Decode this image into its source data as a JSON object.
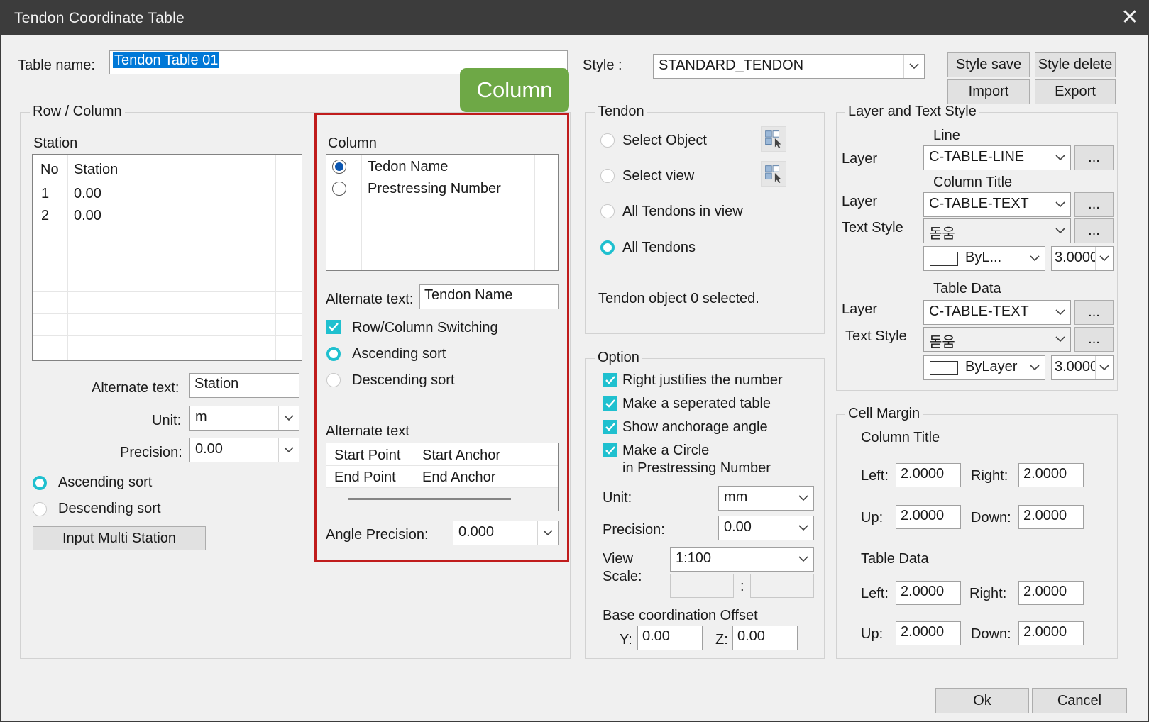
{
  "window": {
    "title": "Tendon Coordinate Table",
    "close_symbol": "✕"
  },
  "table_name": {
    "label": "Table name:",
    "value": "Tendon Table 01"
  },
  "style": {
    "label": "Style :",
    "value": "STANDARD_TENDON",
    "save": "Style save",
    "delete": "Style delete",
    "import": "Import",
    "export": "Export"
  },
  "callout": {
    "text": "Column",
    "color": "#6ea846",
    "highlight_color": "#c01c1c"
  },
  "row_column": {
    "title": "Row / Column",
    "station_label": "Station",
    "headers": [
      "No",
      "Station"
    ],
    "rows": [
      {
        "no": "1",
        "station": "0.00"
      },
      {
        "no": "2",
        "station": "0.00"
      }
    ],
    "alt_text_label": "Alternate text:",
    "alt_text_value": "Station",
    "unit_label": "Unit:",
    "unit_value": "m",
    "precision_label": "Precision:",
    "precision_value": "0.00",
    "ascending": "Ascending sort",
    "descending": "Descending sort",
    "input_multi": "Input Multi Station"
  },
  "column": {
    "title": "Column",
    "items": [
      "Tedon Name",
      "Prestressing Number"
    ],
    "alt_text_label": "Alternate text:",
    "alt_text_value": "Tendon Name",
    "switching": "Row/Column Switching",
    "ascending": "Ascending sort",
    "descending": "Descending sort",
    "alt_text_section": "Alternate text",
    "alt_rows": [
      {
        "a": "Start Point",
        "b": "Start Anchor"
      },
      {
        "a": "End Point",
        "b": "End Anchor"
      }
    ],
    "angle_label": "Angle Precision:",
    "angle_value": "0.000"
  },
  "tendon": {
    "title": "Tendon",
    "select_object": "Select Object",
    "select_view": "Select view",
    "all_in_view": "All Tendons in view",
    "all_tendons": "All Tendons",
    "status": "Tendon object 0 selected."
  },
  "option": {
    "title": "Option",
    "right_justify": "Right justifies the number",
    "separated": "Make a seperated table",
    "anchorage": "Show anchorage angle",
    "circle_1": "Make a Circle",
    "circle_2": "in Prestressing Number",
    "unit_label": "Unit:",
    "unit_value": "mm",
    "precision_label": "Precision:",
    "precision_value": "0.00",
    "view_label_1": "View",
    "view_label_2": "Scale:",
    "view_value": "1:100",
    "colon": ":",
    "base_label": "Base coordination Offset",
    "y_label": "Y:",
    "y_value": "0.00",
    "z_label": "Z:",
    "z_value": "0.00"
  },
  "layer_text": {
    "title": "Layer and Text Style",
    "line": "Line",
    "layer": "Layer",
    "line_layer": "C-TABLE-LINE",
    "column_title": "Column Title",
    "ct_layer": "C-TABLE-TEXT",
    "text_style": "Text Style",
    "ct_font": "돋움",
    "ct_color": "ByL...",
    "ct_height": "3.0000",
    "table_data": "Table Data",
    "td_layer": "C-TABLE-TEXT",
    "td_font": "돋움",
    "td_color": "ByLayer",
    "td_height": "3.0000",
    "dots": "..."
  },
  "cell_margin": {
    "title": "Cell Margin",
    "column_title": "Column Title",
    "table_data": "Table Data",
    "left": "Left:",
    "right": "Right:",
    "up": "Up:",
    "down": "Down:",
    "ct": {
      "left": "2.0000",
      "right": "2.0000",
      "up": "2.0000",
      "down": "2.0000"
    },
    "td": {
      "left": "2.0000",
      "right": "2.0000",
      "up": "2.0000",
      "down": "2.0000"
    }
  },
  "footer": {
    "ok": "Ok",
    "cancel": "Cancel"
  }
}
